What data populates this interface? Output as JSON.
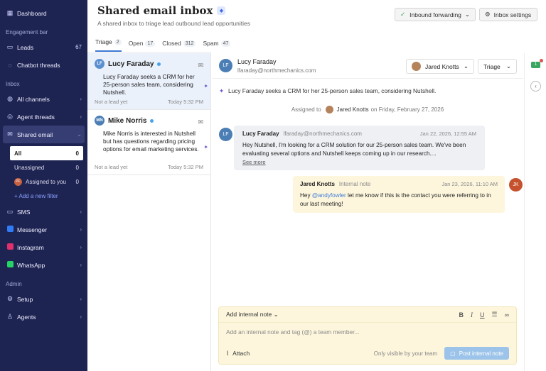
{
  "sidebar": {
    "top_items": [
      {
        "label": "Dashboard",
        "icon": "dashboard-icon"
      }
    ],
    "section_engagement": "Engagement bar",
    "engagement_items": [
      {
        "label": "Leads",
        "count": "67",
        "icon": "leads-icon"
      },
      {
        "label": "Chatbot threads",
        "icon": "chat-icon"
      }
    ],
    "section_inbox": "Inbox",
    "inbox_items": [
      {
        "label": "All channels"
      },
      {
        "label": "Agent threads"
      },
      {
        "label": "Shared email"
      }
    ],
    "shared_email_sub": [
      {
        "label": "All",
        "count": "0"
      },
      {
        "label": "Unassigned",
        "count": "0"
      },
      {
        "label": "Assigned to you",
        "count": "0",
        "avatar": "PF"
      }
    ],
    "add_filter": "+ Add a new filter",
    "channels": [
      {
        "label": "SMS",
        "color": "#ffffff"
      },
      {
        "label": "Messenger",
        "color": "#2f7cf6"
      },
      {
        "label": "Instagram",
        "color": "#e1306c"
      },
      {
        "label": "WhatsApp",
        "color": "#25d366"
      }
    ],
    "section_admin": "Admin",
    "admin_items": [
      {
        "label": "Setup"
      },
      {
        "label": "Agents"
      }
    ]
  },
  "header": {
    "title": "Shared email inbox",
    "subtitle": "A shared inbox to triage lead outbound lead opportunities",
    "forwarding_btn": "Inbound forwarding",
    "settings_btn": "Inbox settings"
  },
  "tabs": [
    {
      "label": "Triage",
      "count": "2"
    },
    {
      "label": "Open",
      "count": "17"
    },
    {
      "label": "Closed",
      "count": "312"
    },
    {
      "label": "Spam",
      "count": "47"
    }
  ],
  "conversations": [
    {
      "initials": "LF",
      "name": "Lucy Faraday",
      "snippet": "Lucy Faraday seeks a CRM for her 25-person sales team, considering Nutshell.",
      "status": "Not a lead yet",
      "time": "Today 5:32 PM"
    },
    {
      "initials": "MN",
      "name": "Mike Norris",
      "snippet": "Mike Norris is interested in Nutshell but has questions regarding pricing options for email marketing services.",
      "status": "Not a lead yet",
      "time": "Today 5:32 PM"
    }
  ],
  "detail": {
    "initials": "LF",
    "name": "Lucy Faraday",
    "email": "lfaraday@northmechanics.com",
    "assignee": "Jared Knotts",
    "stage": "Triage",
    "summary": "Lucy Faraday seeks a CRM for her 25-person sales team, considering Nutshell.",
    "assigned_prefix": "Assigned to",
    "assigned_name": "Jared Knotts",
    "assigned_suffix": "on Friday, February 27, 2026",
    "message": {
      "name": "Lucy Faraday",
      "email": "lfaraday@northmechanics.com",
      "time": "Jan 22, 2026, 12:55 AM",
      "body": "Hey Nutshell, I'm looking for a CRM solution for our 25-person sales team. We've been evaluating several options and Nutshell keeps coming up in our research....",
      "see_more": "See more"
    },
    "note": {
      "name": "Jared Knotts",
      "tag": "Internal note",
      "time": "Jan 23, 2026, 11:10 AM",
      "body_pre": "Hey ",
      "mention": "@andyfowler",
      "body_post": " let me know if this is the contact you were referring to in our last meeting!",
      "initials": "JK"
    },
    "composer": {
      "mode": "Add internal note",
      "placeholder": "Add an internal note and tag (@) a team member...",
      "attach": "Attach",
      "visibility": "Only visible by your team",
      "post": "Post internal note"
    }
  },
  "rail": {
    "badge": "1"
  }
}
